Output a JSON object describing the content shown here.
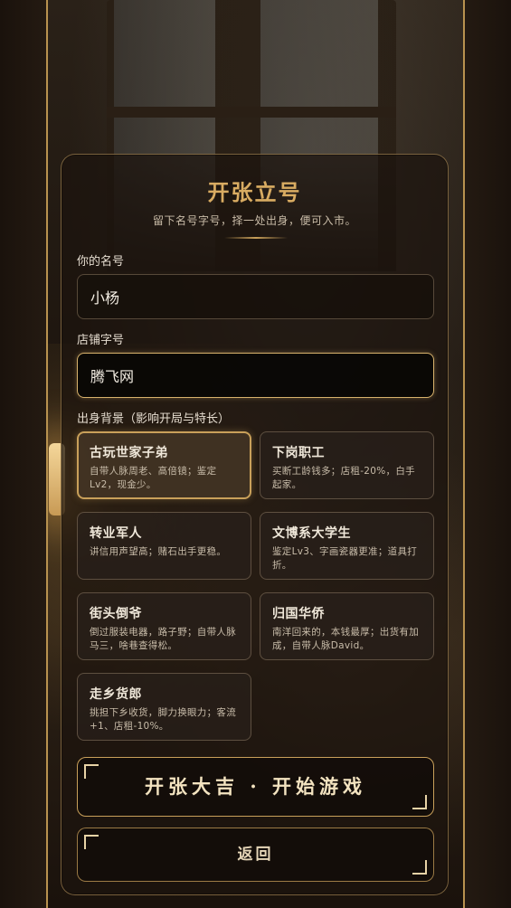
{
  "page": {
    "title": "开张立号",
    "subtitle": "留下名号字号，择一处出身，便可入市。"
  },
  "form": {
    "name_label": "你的名号",
    "name_value": "小杨",
    "shop_label": "店铺字号",
    "shop_value": "腾飞网",
    "background_label": "出身背景（影响开局与特长）"
  },
  "backgrounds": [
    {
      "title": "古玩世家子弟",
      "desc": "自带人脉周老、高倍镜；鉴定Lv2，现金少。",
      "selected": true
    },
    {
      "title": "下岗职工",
      "desc": "买断工龄钱多；店租-20%，白手起家。",
      "selected": false
    },
    {
      "title": "转业军人",
      "desc": "讲信用声望高；赌石出手更稳。",
      "selected": false
    },
    {
      "title": "文博系大学生",
      "desc": "鉴定Lv3、字画瓷器更准；道具打折。",
      "selected": false
    },
    {
      "title": "街头倒爷",
      "desc": "倒过服装电器，路子野；自带人脉马三，啥巷查得松。",
      "selected": false
    },
    {
      "title": "归国华侨",
      "desc": "南洋回来的，本钱最厚；出货有加成，自带人脉David。",
      "selected": false
    },
    {
      "title": "走乡货郎",
      "desc": "挑担下乡收货，脚力换眼力；客流+1、店租-10%。",
      "selected": false
    }
  ],
  "buttons": {
    "start": "开张大吉 · 开始游戏",
    "back": "返回"
  },
  "colors": {
    "accent_gold": "#d9ac62",
    "panel_border": "#c9a05a",
    "text_light": "#f0e8da"
  }
}
